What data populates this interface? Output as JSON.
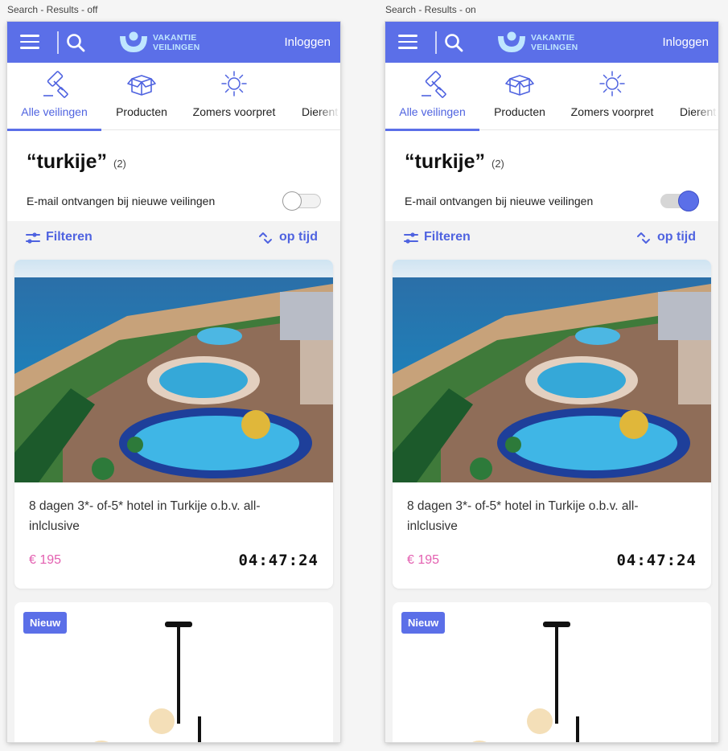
{
  "frames": [
    {
      "label": "Search - Results - off",
      "toggle_on": false
    },
    {
      "label": "Search - Results - on",
      "toggle_on": true
    }
  ],
  "header": {
    "logo_line1": "VAKANTIE",
    "logo_line2": "VEILINGEN",
    "login_label": "Inloggen"
  },
  "categories": [
    {
      "label": "Alle veilingen",
      "icon": "gavel-icon",
      "active": true
    },
    {
      "label": "Producten",
      "icon": "box-icon",
      "active": false
    },
    {
      "label": "Zomers voorpret",
      "icon": "sun-icon",
      "active": false
    },
    {
      "label": "Dierent",
      "icon": "",
      "active": false
    }
  ],
  "search": {
    "query": "“turkije”",
    "count": "(2)",
    "email_label": "E-mail ontvangen bij nieuwe veilingen"
  },
  "controls": {
    "filter_label": "Filteren",
    "sort_label": "op tijd"
  },
  "results": [
    {
      "title": "8 dagen 3*- of-5* hotel in Turkije o.b.v. all-inlclusive",
      "price": "€ 195",
      "timer": "04:47:24",
      "image": "resort-pool-beach-photo"
    },
    {
      "badge": "Nieuw",
      "image": "pendant-lamp-photo"
    }
  ],
  "colors": {
    "brand": "#5b6fe8",
    "price": "#e35fb0",
    "logo_text": "#bfe6ff"
  }
}
